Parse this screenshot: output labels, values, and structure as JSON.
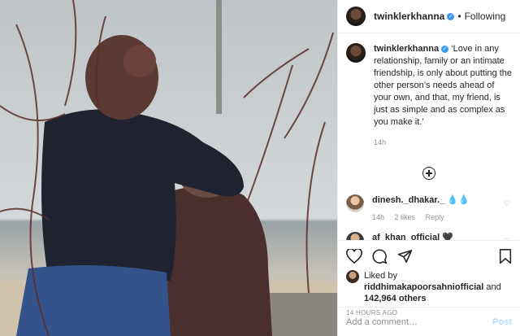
{
  "post": {
    "username": "twinklerkhanna",
    "verified_mark": "✓",
    "separator": "•",
    "follow_state": "Following"
  },
  "caption": {
    "username": "twinklerkhanna",
    "text": "‘Love in any relationship, family or an intimate friendship, is only about putting the other person’s needs ahead of your own, and that, my friend, is just as simple and as complex as you make it.’",
    "age": "14h"
  },
  "comments": [
    {
      "username": "dinesh._dhakar._",
      "text": "💧💧",
      "age": "14h",
      "likes": "2 likes",
      "reply": "Reply"
    },
    {
      "username": "af_khan_official",
      "text": "🖤"
    }
  ],
  "likes": {
    "prefix": "Liked by",
    "user": "riddhimakapoorsahniofficial",
    "and": "and",
    "others": "142,964 others"
  },
  "timestamp": "14 HOURS AGO",
  "add_comment": {
    "placeholder": "Add a comment…",
    "post_label": "Post"
  },
  "icons": [
    "heart-icon",
    "comment-icon",
    "share-icon",
    "bookmark-icon",
    "load-more-icon",
    "verified-icon"
  ],
  "colors": {
    "link_blue": "#3897f0",
    "post_disabled": "#b2dffc",
    "muted": "#8e8e8e"
  }
}
